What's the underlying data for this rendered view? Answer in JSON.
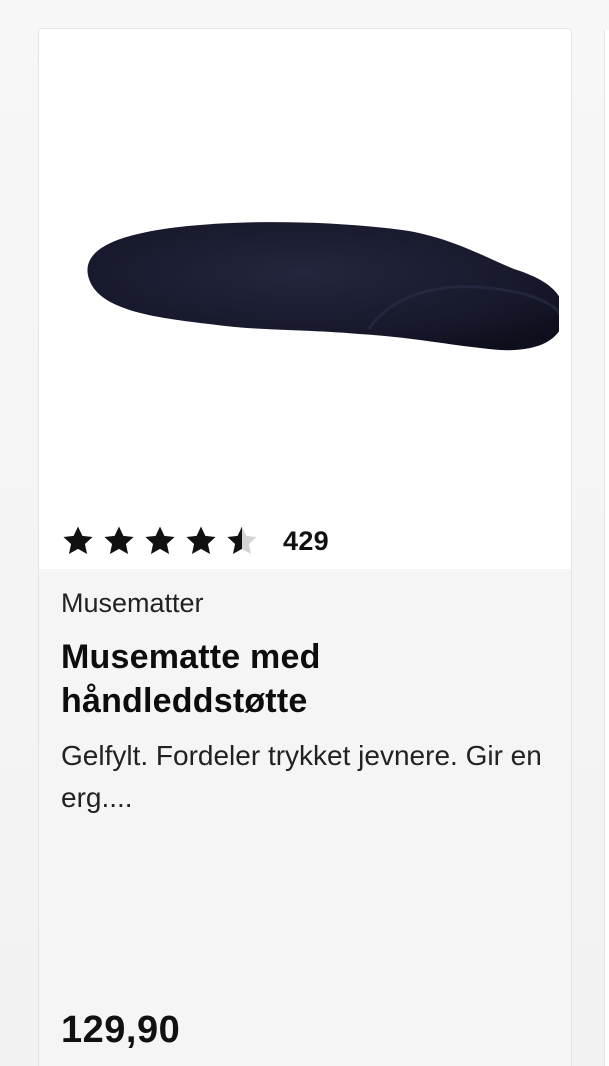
{
  "product": {
    "image_alt": "Black gel-filled mouse pad with wrist rest",
    "rating": {
      "stars": 4.5,
      "max": 5,
      "count": "429"
    },
    "category": "Musematter",
    "title": "Musematte med håndleddstøtte",
    "description": "Gelfylt. Fordeler trykket jevnere. Gir en erg....",
    "price": "129,90"
  },
  "colors": {
    "star_filled": "#111111",
    "star_empty": "#d4d4d4",
    "pad_color": "#15162a"
  }
}
